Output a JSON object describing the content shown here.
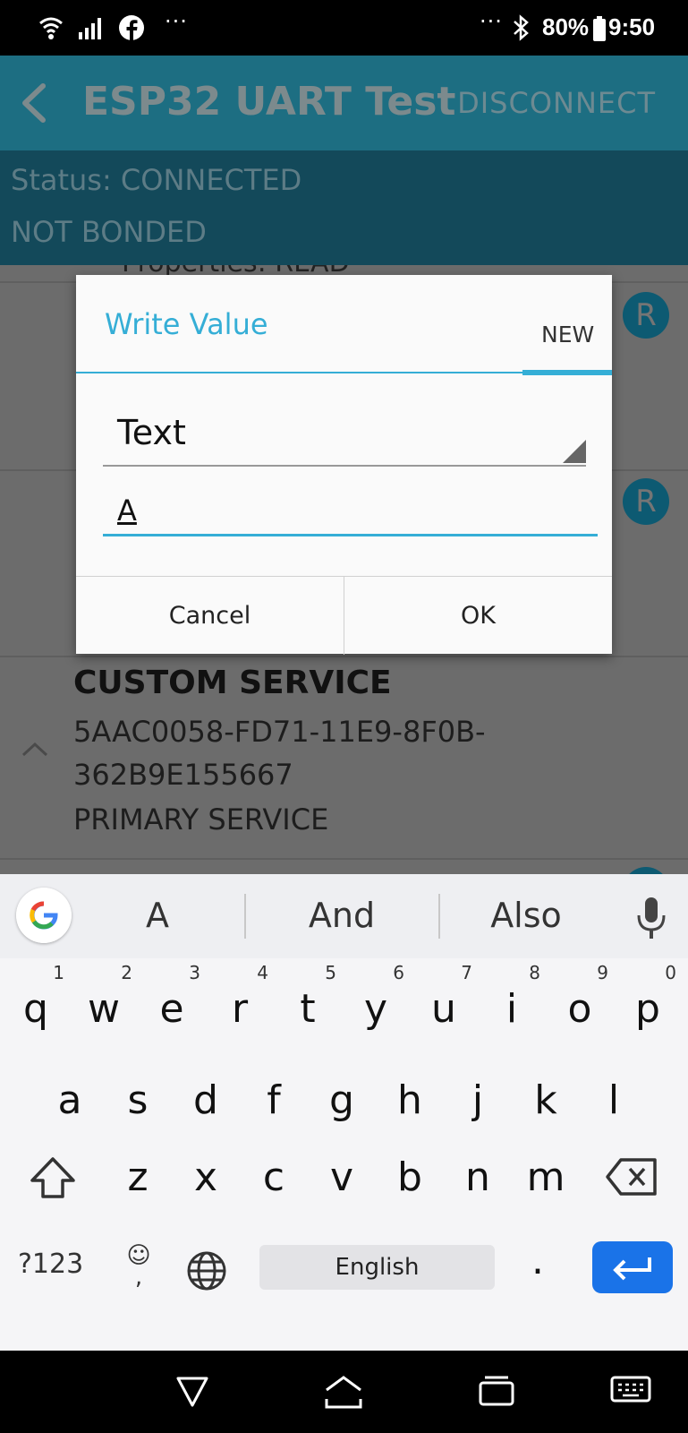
{
  "status_bar": {
    "battery": "80%",
    "time": "9:50",
    "left_more": "···",
    "right_more": "···"
  },
  "app_bar": {
    "title": "ESP32 UART Test",
    "action": "DISCONNECT"
  },
  "status_panel": {
    "status": "Status: CONNECTED",
    "bond": "NOT BONDED"
  },
  "list": {
    "cut_properties": "Properties: READ",
    "badge_label": "R",
    "service": {
      "title": "CUSTOM SERVICE",
      "uuid_line1": "5AAC0058-FD71-11E9-8F0B-",
      "uuid_line2": "362B9E155667",
      "kind": "PRIMARY SERVICE"
    }
  },
  "dialog": {
    "title": "Write Value",
    "tab": "NEW",
    "type_selected": "Text",
    "value": "A",
    "cancel": "Cancel",
    "ok": "OK"
  },
  "keyboard": {
    "suggestions": [
      "A",
      "And",
      "Also"
    ],
    "row1": [
      {
        "k": "q",
        "h": "1"
      },
      {
        "k": "w",
        "h": "2"
      },
      {
        "k": "e",
        "h": "3"
      },
      {
        "k": "r",
        "h": "4"
      },
      {
        "k": "t",
        "h": "5"
      },
      {
        "k": "y",
        "h": "6"
      },
      {
        "k": "u",
        "h": "7"
      },
      {
        "k": "i",
        "h": "8"
      },
      {
        "k": "o",
        "h": "9"
      },
      {
        "k": "p",
        "h": "0"
      }
    ],
    "row2": [
      "a",
      "s",
      "d",
      "f",
      "g",
      "h",
      "j",
      "k",
      "l"
    ],
    "row3": [
      "z",
      "x",
      "c",
      "v",
      "b",
      "n",
      "m"
    ],
    "symbols": "?123",
    "emoji": "☺",
    "emoji_comma": ",",
    "space": "English",
    "period": "."
  },
  "colors": {
    "app_bar": "#1d6e82",
    "accent": "#35aed6",
    "enter_key": "#1a73e8"
  }
}
